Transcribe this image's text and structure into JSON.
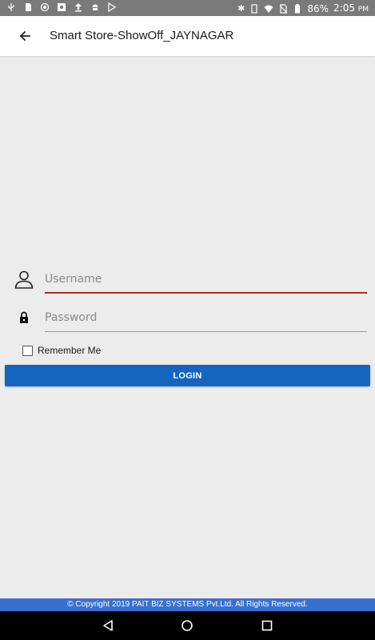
{
  "status_bar": {
    "battery_percent": "86%",
    "time": "2:05",
    "time_suffix": "PM"
  },
  "app_bar": {
    "title": "Smart Store-ShowOff_JAYNAGAR"
  },
  "form": {
    "username": {
      "value": "",
      "placeholder": "Username"
    },
    "password": {
      "value": "",
      "placeholder": "Password"
    },
    "remember_label": "Remember Me",
    "remember_checked": false,
    "login_label": "LOGIN"
  },
  "footer": {
    "copyright": "© Copyright 2019 PAIT BIZ SYSTEMS Pvt.Ltd. All Rights Reserved."
  },
  "colors": {
    "accent_button": "#1565c0",
    "active_underline": "#b02a2a",
    "footer_bg": "#3a6fd0",
    "background": "#ececec"
  },
  "icons": {
    "back": "arrow-left-icon",
    "username": "user-icon",
    "password": "lock-icon",
    "nav_back": "triangle-back-icon",
    "nav_home": "circle-home-icon",
    "nav_recent": "square-recents-icon"
  }
}
